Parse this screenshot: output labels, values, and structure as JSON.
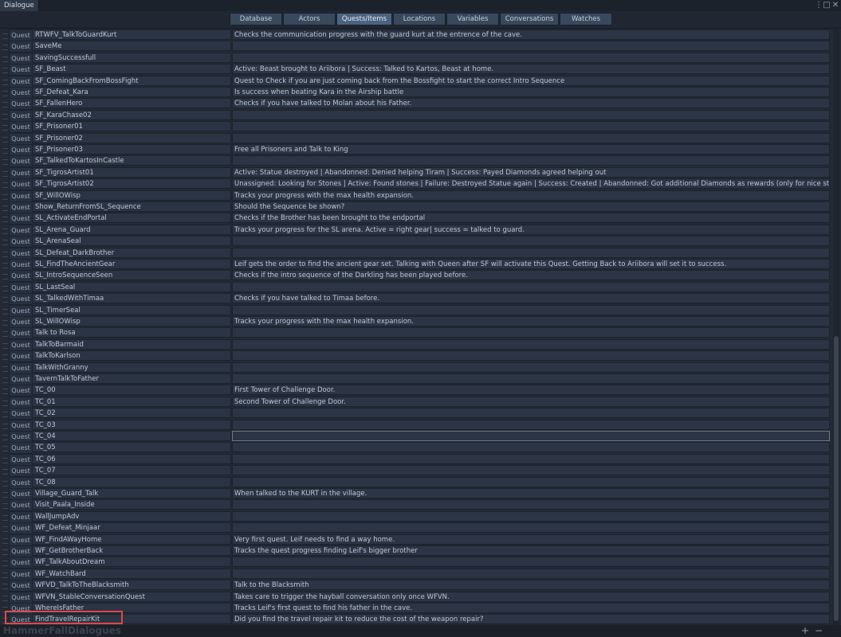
{
  "window": {
    "title": "Dialogue",
    "menu_icon": "⋮",
    "maximize_icon": "□",
    "close_icon": "✕"
  },
  "tabs": [
    {
      "label": "Database"
    },
    {
      "label": "Actors"
    },
    {
      "label": "Quests/Items",
      "active": true
    },
    {
      "label": "Locations"
    },
    {
      "label": "Variables"
    },
    {
      "label": "Conversations"
    },
    {
      "label": "Watches"
    }
  ],
  "rows": [
    {
      "type": "Quest",
      "name": "RTWFV_TalkToGuardKurt",
      "desc": "Checks the communication progress with the guard kurt at the entrence of the cave."
    },
    {
      "type": "Quest",
      "name": "SaveMe",
      "desc": ""
    },
    {
      "type": "Quest",
      "name": "SavingSuccessfull",
      "desc": ""
    },
    {
      "type": "Quest",
      "name": "SF_Beast",
      "desc": "Active: Beast brought to Ariibora | Success: Talked to Kartos, Beast at home."
    },
    {
      "type": "Quest",
      "name": "SF_ComingBackFromBossFight",
      "desc": "Quest to Check if you are just coming back from the Bossfight to start the correct Intro Sequence"
    },
    {
      "type": "Quest",
      "name": "SF_Defeat_Kara",
      "desc": "Is success when beating Kara in the Airship battle"
    },
    {
      "type": "Quest",
      "name": "SF_FallenHero",
      "desc": "Checks if you have talked to Molan about his Father."
    },
    {
      "type": "Quest",
      "name": "SF_KaraChase02",
      "desc": ""
    },
    {
      "type": "Quest",
      "name": "SF_Prisoner01",
      "desc": ""
    },
    {
      "type": "Quest",
      "name": "SF_Prisoner02",
      "desc": ""
    },
    {
      "type": "Quest",
      "name": "SF_Prisoner03",
      "desc": "Free all Prisoners and Talk to King"
    },
    {
      "type": "Quest",
      "name": "SF_TalkedToKartosInCastle",
      "desc": ""
    },
    {
      "type": "Quest",
      "name": "SF_TigrosArtist01",
      "desc": "Active: Statue destroyed | Abandonned: Denied helping Tiram | Success: Payed Diamonds agreed helping out"
    },
    {
      "type": "Quest",
      "name": "SF_TigrosArtist02",
      "desc": "Unassigned: Looking for Stones | Active: Found stones | Failure: Destroyed Statue again | Success: Created  | Abandonned: Got additional Diamonds as rewards (only for nice statue)"
    },
    {
      "type": "Quest",
      "name": "SF_WillOWisp",
      "desc": "Tracks your progress with the max health expansion."
    },
    {
      "type": "Quest",
      "name": "Show_ReturnFromSL_Sequence",
      "desc": "Should the Sequence be shown?"
    },
    {
      "type": "Quest",
      "name": "SL_ActivateEndPortal",
      "desc": "Checks if the Brother has been brought to the endportal"
    },
    {
      "type": "Quest",
      "name": "SL_Arena_Guard",
      "desc": "Tracks your progress for the SL arena. Active = right gear| success = talked to guard."
    },
    {
      "type": "Quest",
      "name": "SL_ArenaSeal",
      "desc": ""
    },
    {
      "type": "Quest",
      "name": "SL_Defeat_DarkBrother",
      "desc": ""
    },
    {
      "type": "Quest",
      "name": "SL_FindTheAncientGear",
      "desc": "Leif gets the order to find the ancient gear set. Talking with Queen after SF will activate this Quest. Getting Back to Ariibora will set it to success."
    },
    {
      "type": "Quest",
      "name": "SL_IntroSequenceSeen",
      "desc": "Checks if the intro sequence of the Darkling has been played before."
    },
    {
      "type": "Quest",
      "name": "SL_LastSeal",
      "desc": ""
    },
    {
      "type": "Quest",
      "name": "SL_TalkedWithTimaa",
      "desc": "Checks if you have talked to Timaa before."
    },
    {
      "type": "Quest",
      "name": "SL_TimerSeal",
      "desc": ""
    },
    {
      "type": "Quest",
      "name": "SL_WillOWisp",
      "desc": "Tracks your progress with the max health expansion."
    },
    {
      "type": "Quest",
      "name": "Talk to Rosa",
      "desc": ""
    },
    {
      "type": "Quest",
      "name": "TalkToBarmaid",
      "desc": ""
    },
    {
      "type": "Quest",
      "name": "TalkToKarlson",
      "desc": ""
    },
    {
      "type": "Quest",
      "name": "TalkWithGranny",
      "desc": ""
    },
    {
      "type": "Quest",
      "name": "TavernTalkToFather",
      "desc": ""
    },
    {
      "type": "Quest",
      "name": "TC_00",
      "desc": "First Tower of Challenge Door."
    },
    {
      "type": "Quest",
      "name": "TC_01",
      "desc": "Second Tower of Challenge Door."
    },
    {
      "type": "Quest",
      "name": "TC_02",
      "desc": ""
    },
    {
      "type": "Quest",
      "name": "TC_03",
      "desc": ""
    },
    {
      "type": "Quest",
      "name": "TC_04",
      "desc": "",
      "focused": true
    },
    {
      "type": "Quest",
      "name": "TC_05",
      "desc": ""
    },
    {
      "type": "Quest",
      "name": "TC_06",
      "desc": ""
    },
    {
      "type": "Quest",
      "name": "TC_07",
      "desc": ""
    },
    {
      "type": "Quest",
      "name": "TC_08",
      "desc": ""
    },
    {
      "type": "Quest",
      "name": "Village_Guard_Talk",
      "desc": "When talked to the KURT in the village."
    },
    {
      "type": "Quest",
      "name": "Visit_Paala_Inside",
      "desc": ""
    },
    {
      "type": "Quest",
      "name": "WallJumpAdv",
      "desc": ""
    },
    {
      "type": "Quest",
      "name": "WF_Defeat_Minjaar",
      "desc": ""
    },
    {
      "type": "Quest",
      "name": "WF_FindAWayHome",
      "desc": "Very first quest. Leif needs to find a way home."
    },
    {
      "type": "Quest",
      "name": "WF_GetBrotherBack",
      "desc": "Tracks the quest progress finding Leif's bigger brother"
    },
    {
      "type": "Quest",
      "name": "WF_TalkAboutDream",
      "desc": ""
    },
    {
      "type": "Quest",
      "name": "WF_WatchBard",
      "desc": ""
    },
    {
      "type": "Quest",
      "name": "WFVD_TalkToTheBlacksmith",
      "desc": "Talk to the Blacksmith"
    },
    {
      "type": "Quest",
      "name": "WFVN_StableConversationQuest",
      "desc": "Takes care to trigger the hayball conversation only once WFVN."
    },
    {
      "type": "Quest",
      "name": "WhereIsFather",
      "desc": "Tracks Leif's first quest to find his father in the cave."
    },
    {
      "type": "Quest",
      "name": "FindTravelRepairKit",
      "desc": "Did you find the travel repair kit to reduce the cost of the weapon repair?",
      "highlighted": true
    }
  ],
  "footer": {
    "watermark": "HammerFallDialogues",
    "add_label": "+",
    "remove_label": "−"
  },
  "colors": {
    "background": "#232a35",
    "tab_active": "#4b6380",
    "highlight": "#e0474a"
  }
}
